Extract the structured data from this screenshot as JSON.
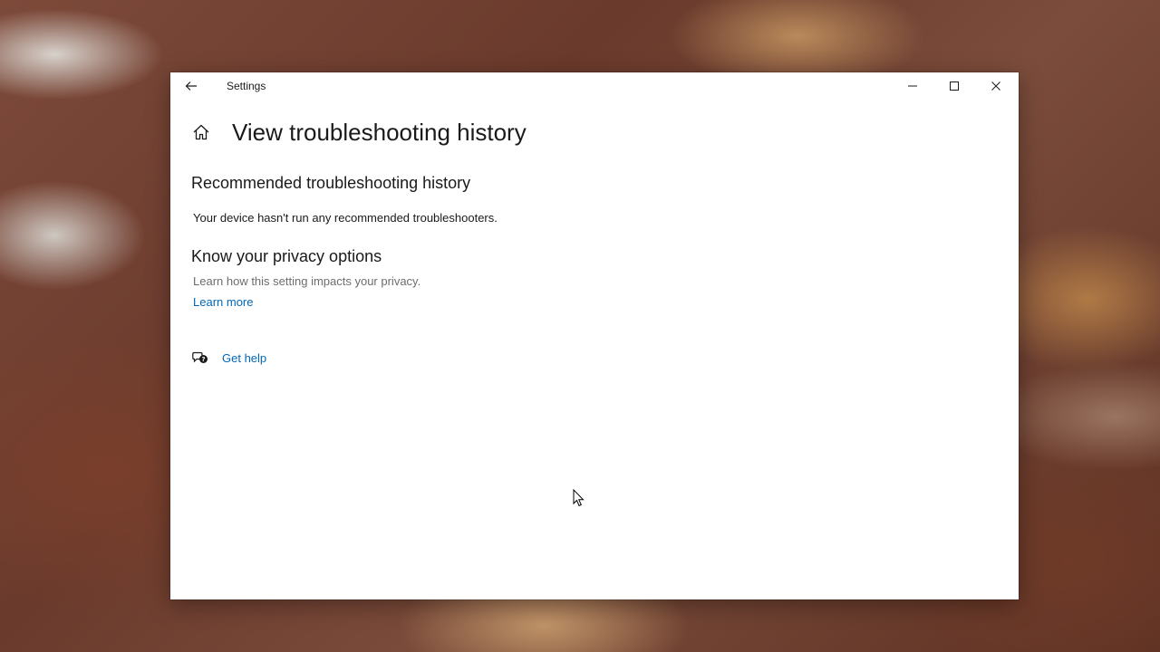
{
  "window": {
    "title": "Settings"
  },
  "page": {
    "title": "View troubleshooting history"
  },
  "recommended": {
    "heading": "Recommended troubleshooting history",
    "text": "Your device hasn't run any recommended troubleshooters."
  },
  "privacy": {
    "heading": "Know your privacy options",
    "text": "Learn how this setting impacts your privacy.",
    "link": "Learn more"
  },
  "help": {
    "link": "Get help"
  },
  "icons": {
    "back": "back-arrow-icon",
    "home": "home-icon",
    "minimize": "minimize-icon",
    "maximize": "maximize-icon",
    "close": "close-icon",
    "help": "chat-help-icon"
  },
  "colors": {
    "link": "#0067b8",
    "text": "#1a1a1a",
    "secondary_text": "#6d6d6d",
    "window_bg": "#ffffff"
  }
}
